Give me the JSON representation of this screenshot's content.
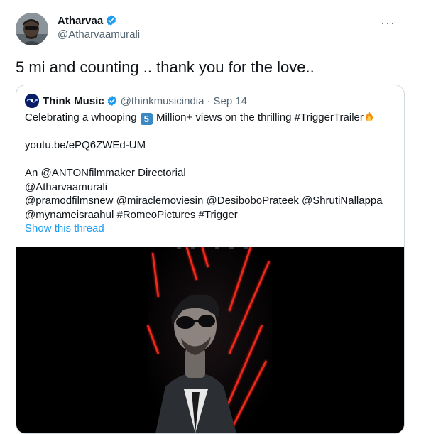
{
  "tweet": {
    "author_name": "Atharvaa",
    "author_handle": "@Atharvaamurali",
    "more_icon": "more-horizontal-icon",
    "text": "5 mi and counting .. thank you for the love.."
  },
  "quote": {
    "name": "Think Music",
    "handle": "@thinkmusicindia",
    "separator": "·",
    "date": "Sep 14",
    "line1_pre": "Celebrating a whooping ",
    "badge": "5",
    "line1_post": " Million+ views on the thrilling #TriggerTrailer",
    "link": "youtu.be/ePQ6ZWEd-UM",
    "credits": [
      "An @ANTONfilmmaker Directorial",
      "@Atharvaamurali",
      "@pramodfilmsnew @miraclemoviesin @DesiboboPrateek @ShrutiNallappa",
      "@mynameisraahul #RomeoPictures #Trigger"
    ],
    "show_thread": "Show this thread"
  },
  "colors": {
    "link_blue": "#1d9bf0",
    "verified_blue": "#1d9bf0",
    "secondary_text": "#536471",
    "laser_red": "#ff2a1e",
    "card_border": "#cfd9de"
  }
}
